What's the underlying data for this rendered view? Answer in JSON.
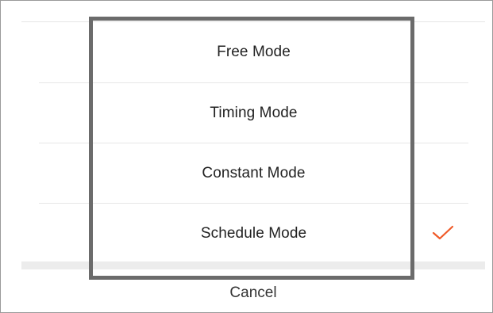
{
  "mode_menu": {
    "options": [
      {
        "label": "Free Mode",
        "selected": false
      },
      {
        "label": "Timing Mode",
        "selected": false
      },
      {
        "label": "Constant Mode",
        "selected": false
      },
      {
        "label": "Schedule Mode",
        "selected": true
      }
    ],
    "selected_icon": "checkmark-icon",
    "accent_color": "#f05a28",
    "cancel_label": "Cancel"
  }
}
